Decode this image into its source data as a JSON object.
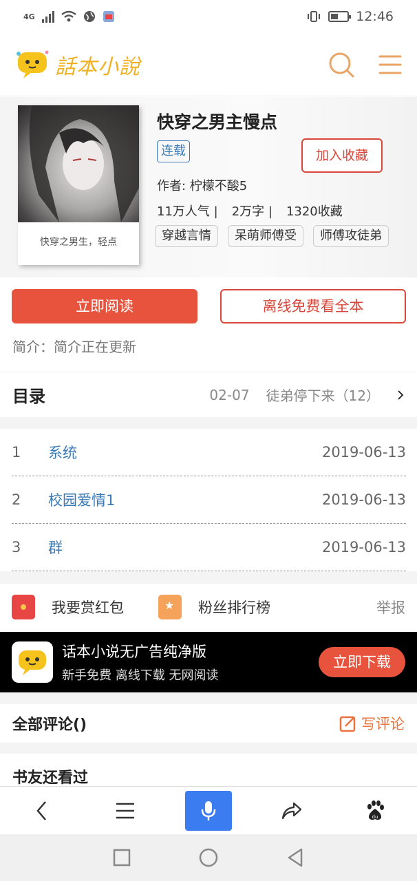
{
  "status_bar": {
    "network": "4G",
    "time": "12:46"
  },
  "header": {
    "logo_text": "話本小說",
    "search_icon": "search-icon",
    "menu_icon": "menu-icon",
    "accent_color": "#e8a565"
  },
  "book": {
    "title": "快穿之男主慢点",
    "status": "连载",
    "favorite_label": "加入收藏",
    "author": "作者: 柠檬不酸5",
    "popularity": "11万人气 |",
    "word_count": "2万字 |",
    "favorites": "1320收藏",
    "cover_caption": "快穿之男生，轻点",
    "tags": [
      "穿越言情",
      "呆萌师傅受",
      "师傅攻徒弟"
    ]
  },
  "actions": {
    "read_now": "立即阅读",
    "offline_read": "离线免费看全本"
  },
  "intro": "简介：简介正在更新",
  "catalog": {
    "title": "目录",
    "latest_date": "02-07",
    "latest_chapter": "徒弟停下来（12）",
    "chapters": [
      {
        "num": "1",
        "title": "系统",
        "date": "2019-06-13"
      },
      {
        "num": "2",
        "title": "校园爱情1",
        "date": "2019-06-13"
      },
      {
        "num": "3",
        "title": "群",
        "date": "2019-06-13"
      }
    ]
  },
  "reward": {
    "red_packet": "我要赏红包",
    "fan_rank": "粉丝排行榜",
    "report": "举报"
  },
  "ad": {
    "title": "话本小说无广告纯净版",
    "subtitle": "新手免费 离线下载 无网阅读",
    "button": "立即下载"
  },
  "comments": {
    "title": "全部评论()",
    "write": "写评论"
  },
  "also_read": "书友还看过",
  "colors": {
    "primary_red": "#e8533d",
    "link_blue": "#3a7ab5",
    "mic_blue": "#3b7cf0"
  }
}
